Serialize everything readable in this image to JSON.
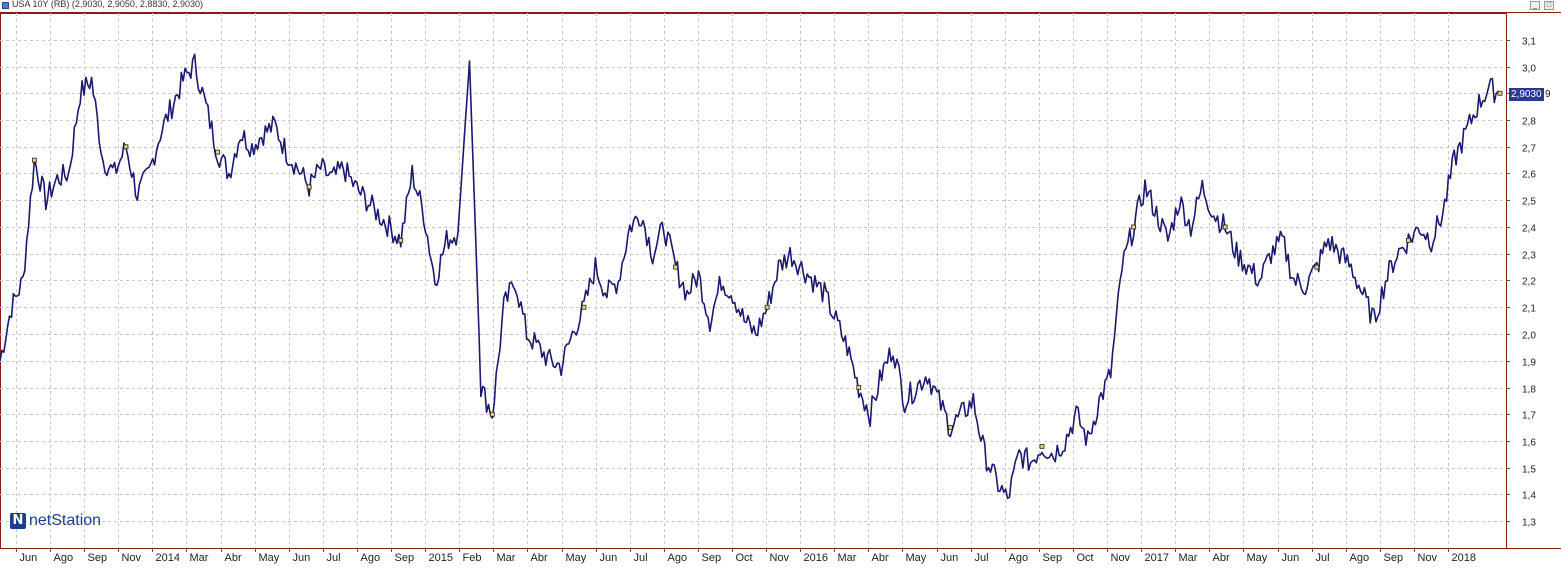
{
  "window": {
    "title": "USA 10Y (RB) (2,9030, 2,9050, 2,8830, 2,9030)",
    "minimize_label": "_",
    "maximize_label": "□"
  },
  "logo": {
    "mark": "N",
    "brand": "netStation"
  },
  "price_label": {
    "value": "2,9030",
    "trailing": "9"
  },
  "colors": {
    "line": "#1a1a6e",
    "frame": "#8b1a1a",
    "grid": "#c8c8c8",
    "price_bg": "#2b3a8c"
  },
  "chart_data": {
    "type": "line",
    "title": "USA 10Y (RB)",
    "ylim": [
      1.2,
      3.2
    ],
    "grid": true,
    "y_ticks": [
      "1,3",
      "1,4",
      "1,5",
      "1,6",
      "1,7",
      "1,8",
      "1,9",
      "2,0",
      "2,1",
      "2,2",
      "2,3",
      "2,4",
      "2,5",
      "2,6",
      "2,7",
      "2,8",
      "2,9",
      "3,0",
      "3,1"
    ],
    "x_tick_labels": [
      "Jun",
      "Ago",
      "Sep",
      "Nov",
      "2014",
      "Mar",
      "Abr",
      "May",
      "Jun",
      "Jul",
      "Ago",
      "Sep",
      "2015",
      "Feb",
      "Mar",
      "Abr",
      "May",
      "Jun",
      "Jul",
      "Ago",
      "Sep",
      "Oct",
      "Nov",
      "2016",
      "Mar",
      "Abr",
      "May",
      "Jun",
      "Jul",
      "Ago",
      "Sep",
      "Oct",
      "Nov",
      "2017",
      "Mar",
      "Abr",
      "May",
      "Jun",
      "Jul",
      "Ago",
      "Sep",
      "Nov",
      "2018"
    ],
    "series": [
      {
        "values": [
          1.9,
          2.1,
          2.2,
          2.65,
          2.5,
          2.58,
          2.6,
          2.9,
          2.95,
          2.65,
          2.6,
          2.7,
          2.52,
          2.6,
          2.75,
          2.85,
          2.95,
          3.01,
          2.85,
          2.68,
          2.6,
          2.75,
          2.7,
          2.75,
          2.78,
          2.68,
          2.62,
          2.55,
          2.62,
          2.58,
          2.62,
          2.55,
          2.5,
          2.45,
          2.4,
          2.35,
          2.6,
          2.45,
          2.2,
          2.35,
          2.38,
          3.02,
          1.8,
          1.7,
          2.1,
          2.2,
          2.0,
          1.95,
          1.9,
          1.88,
          2.0,
          2.1,
          2.25,
          2.15,
          2.2,
          2.4,
          2.45,
          2.3,
          2.4,
          2.25,
          2.15,
          2.22,
          2.05,
          2.2,
          2.15,
          2.05,
          2.0,
          2.1,
          2.25,
          2.3,
          2.25,
          2.2,
          2.15,
          2.05,
          1.95,
          1.8,
          1.7,
          1.85,
          1.95,
          1.75,
          1.8,
          1.85,
          1.75,
          1.65,
          1.7,
          1.75,
          1.55,
          1.45,
          1.38,
          1.55,
          1.52,
          1.58,
          1.55,
          1.6,
          1.7,
          1.6,
          1.75,
          1.85,
          2.25,
          2.4,
          2.55,
          2.45,
          2.35,
          2.5,
          2.4,
          2.55,
          2.45,
          2.4,
          2.3,
          2.25,
          2.2,
          2.3,
          2.35,
          2.2,
          2.18,
          2.25,
          2.35,
          2.3,
          2.25,
          2.15,
          2.05,
          2.2,
          2.3,
          2.35,
          2.4,
          2.35,
          2.45,
          2.65,
          2.75,
          2.85,
          2.92,
          2.9
        ]
      }
    ],
    "last_value": 2.903
  }
}
